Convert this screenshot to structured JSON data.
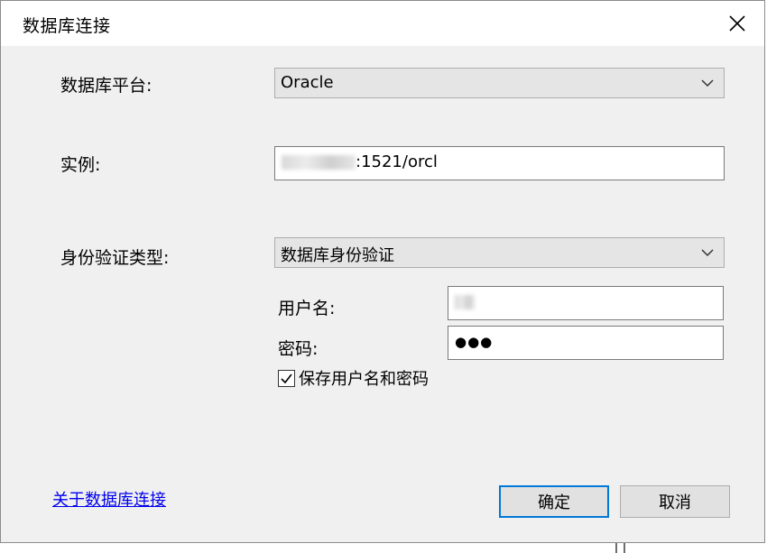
{
  "window": {
    "title": "数据库连接"
  },
  "platform": {
    "label": "数据库平台:",
    "selected": "Oracle"
  },
  "instance": {
    "label": "实例:",
    "value": ":1521/orcl"
  },
  "auth": {
    "label": "身份验证类型:",
    "selected": "数据库身份验证",
    "username_label": "用户名:",
    "password_label": "密码:",
    "password_value": "●●●",
    "save_label": "保存用户名和密码",
    "save_checked": true
  },
  "footer": {
    "about_link": "关于数据库连接",
    "ok_label": "确定",
    "cancel_label": "取消"
  },
  "icons": {
    "close": "close-icon",
    "dropdown": "chevron-down-icon",
    "check": "checkmark-icon"
  },
  "colors": {
    "link": "#0000ee",
    "default_button_border": "#0078d7",
    "dialog_bg": "#f0f0f0"
  }
}
